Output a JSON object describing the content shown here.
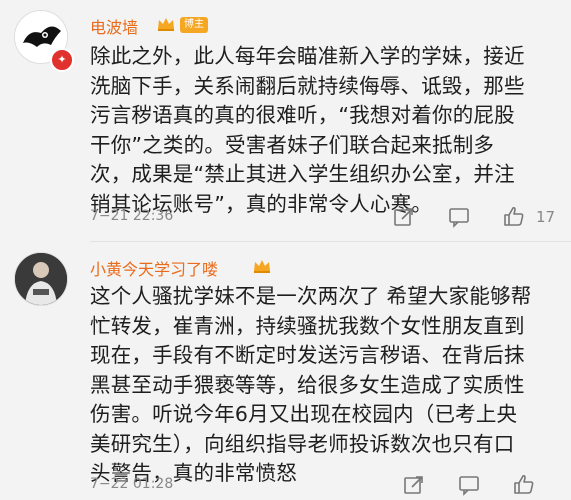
{
  "comments": [
    {
      "username": "电波墙",
      "author_tag": "博主",
      "text_lines": [
        "除此之外，此人每年会瞄准新入学的学妹，接近",
        "洗脑下手，关系闹翻后就持续侮辱、诋毁，那些",
        "污言秽语真的真的很难听，“我想对着你的屁股",
        "干你”之类的。受害者妹子们联合起来抵制多",
        "次，成果是“禁止其进入学生组织办公室，并注",
        "销其论坛账号”，真的非常令人心寒。"
      ],
      "time": "7−21 22:36",
      "like_count": "17",
      "icons": [
        "share-icon",
        "comment-icon",
        "like-icon"
      ]
    },
    {
      "username": "小黄今天学习了喽",
      "text_lines": [
        "这个人骚扰学妹不是一次两次了 希望大家能够帮",
        "忙转发，崔青洲，持续骚扰我数个女性朋友直到",
        "现在，手段有不断定时发送污言秽语、在背后抹",
        "黑甚至动手猥亵等等，给很多女生造成了实质性",
        "伤害。听说今年6月又出现在校园内（已考上央",
        "美研究生），向组织指导老师投诉数次也只有口",
        "头警告，真的非常愤怒"
      ],
      "time": "7−22 01:28",
      "icons": [
        "share-icon",
        "comment-icon",
        "like-icon"
      ]
    }
  ],
  "colors": {
    "username": "#e96b1b",
    "badge": "#f5a623",
    "background": "#f3f3f3"
  }
}
